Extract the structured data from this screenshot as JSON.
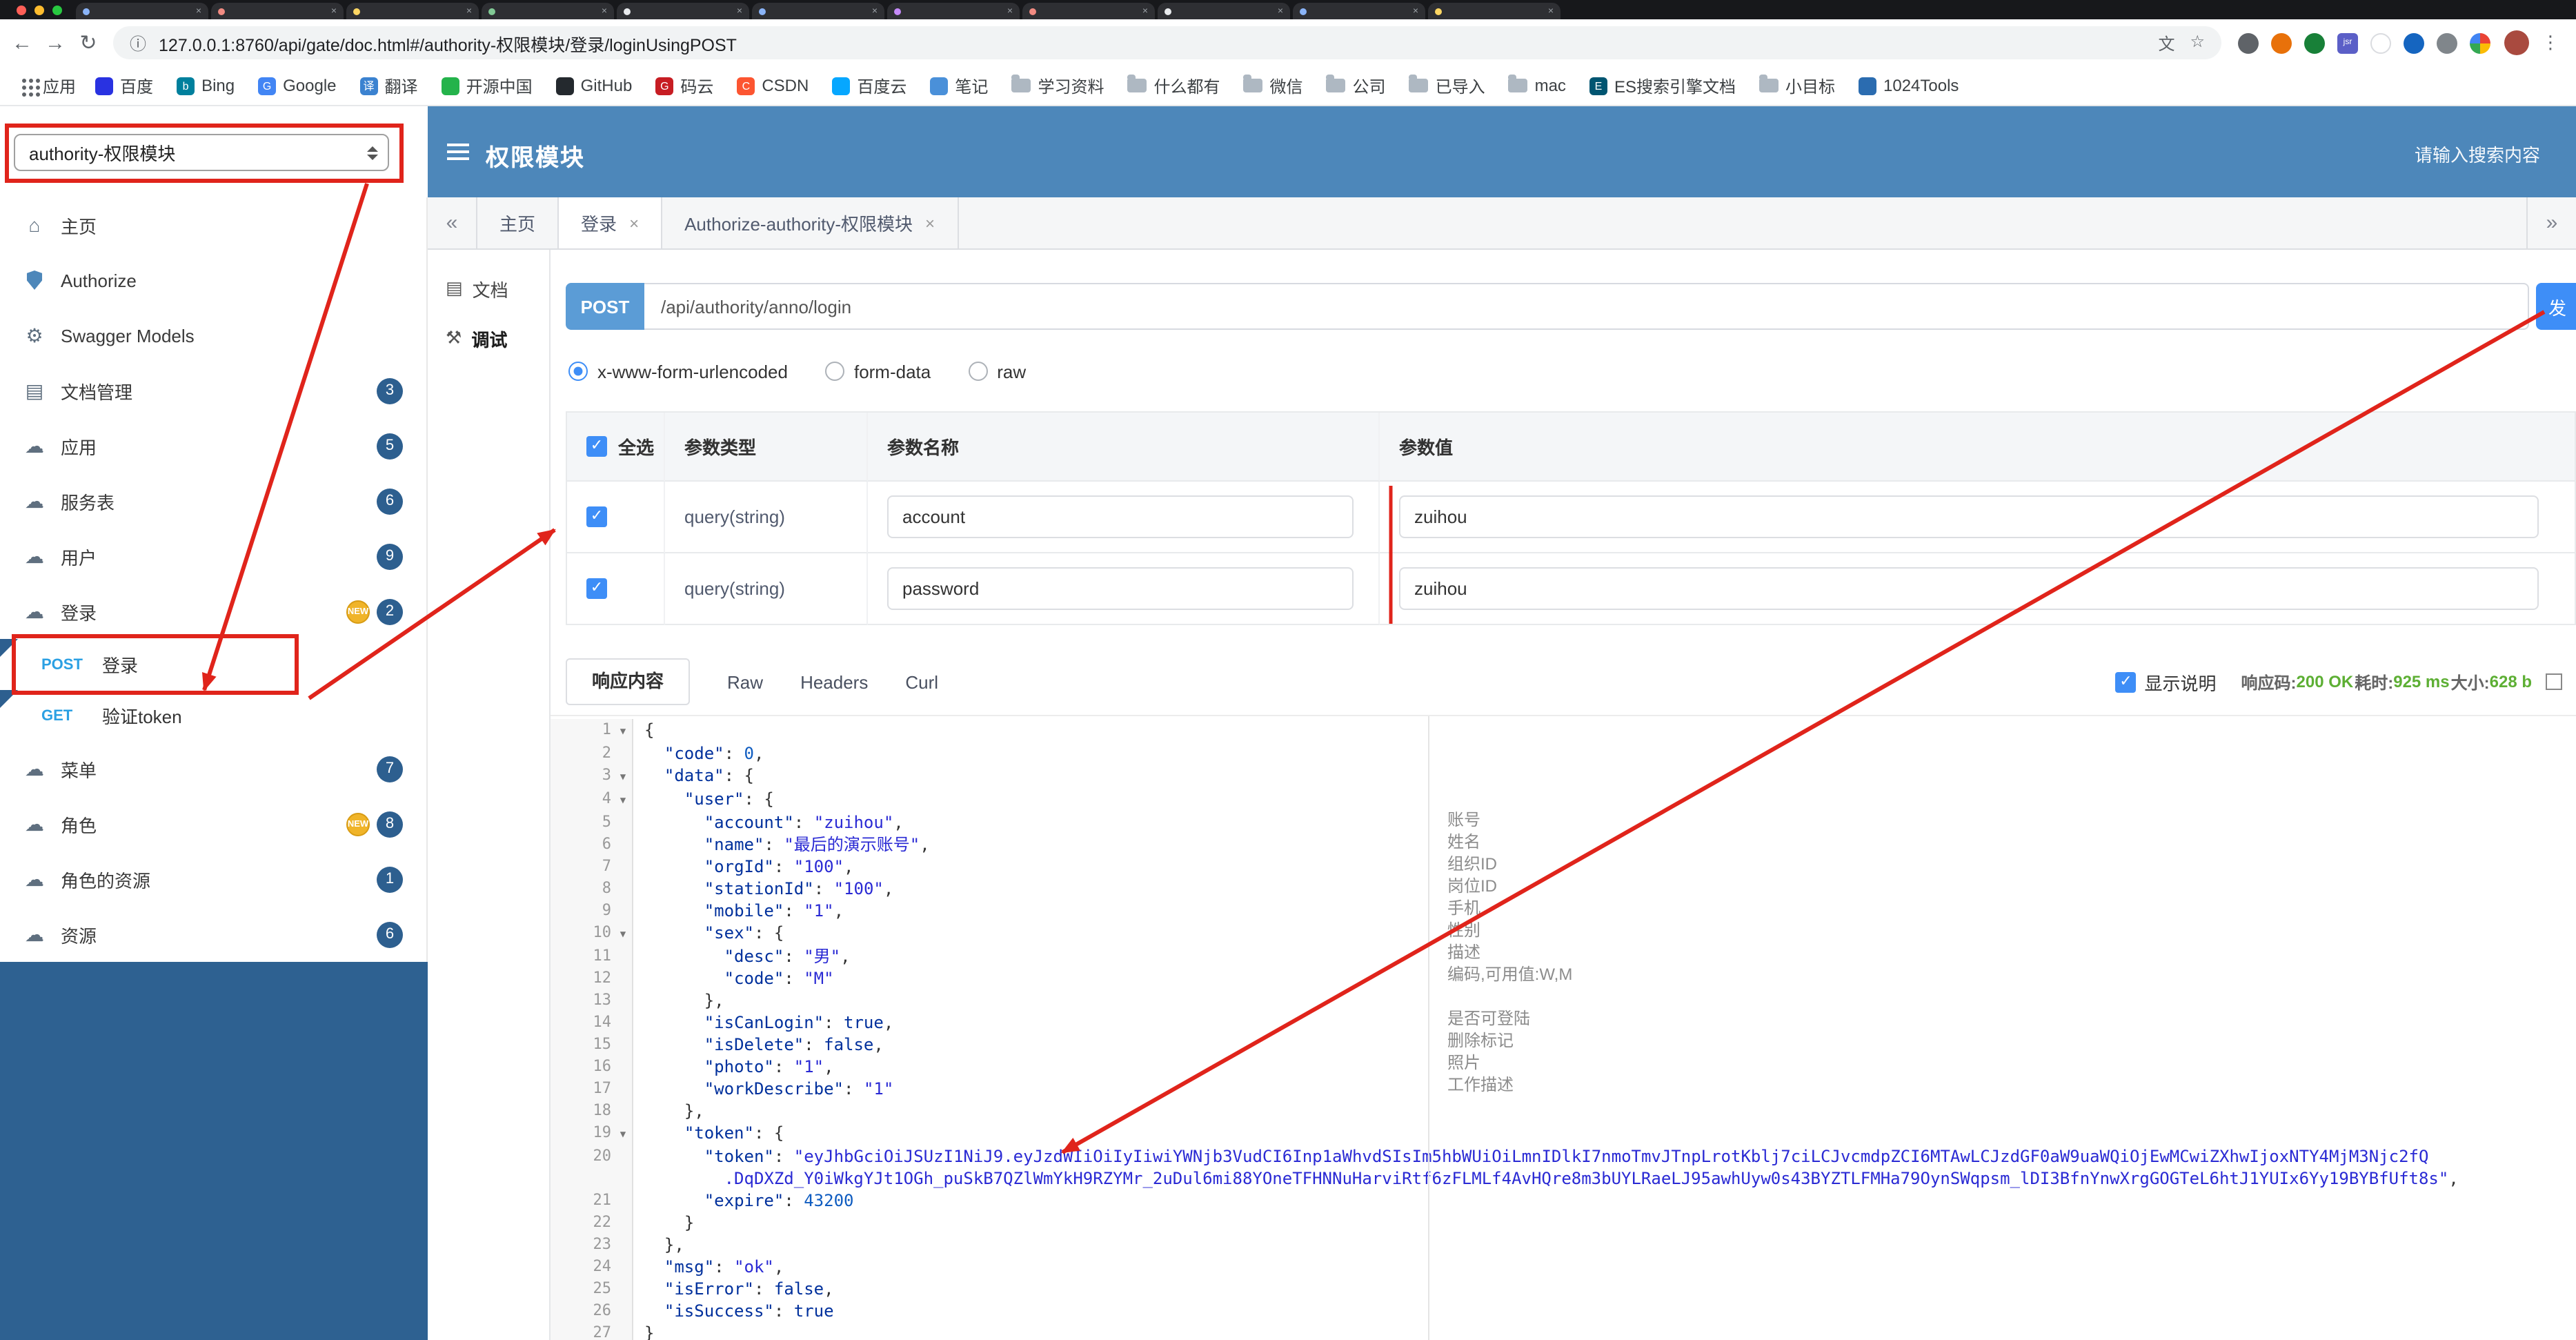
{
  "colors": {
    "header_blue": "#4d87ba",
    "sidebar_footer_blue": "#2e6191",
    "method_badge_blue": "#5b9cd6",
    "primary_blue": "#3e8ef7",
    "badge_navy": "#2d5f8f",
    "new_gold": "#f0b429",
    "success_green": "#5daf34",
    "annotation_red": "#e0241b"
  },
  "icon_glyphs": {
    "back-icon": "←",
    "forward-icon": "→",
    "reload-icon": "↻",
    "info-icon": "ⓘ",
    "star-icon": "☆",
    "translate-icon": "文",
    "overflow-icon": "⋮",
    "close-icon": "×",
    "chevron-left-icon": "«",
    "chevron-right-icon": "»",
    "home-icon": "⌂",
    "models-icon": "⚙",
    "doc-icon": "▤",
    "cloud-icon": "☁",
    "debug-icon": "⚒",
    "fold-icon": "▼",
    "check-icon": "✓"
  },
  "browser": {
    "url": "127.0.0.1:8760/api/gate/doc.html#/authority-权限模块/登录/loginUsingPOST",
    "tab_favicon_colors": [
      "#8ab4f8",
      "#f28b82",
      "#fdd663",
      "#81c995",
      "#e8eaed",
      "#8ab4f8",
      "#c58af9",
      "#f28b82",
      "#e8eaed",
      "#8ab4f8",
      "#fdd663"
    ],
    "extensions": [
      {
        "color": "#5f6368"
      },
      {
        "color": "#e8710a"
      },
      {
        "color": "#188038"
      },
      {
        "color": "#5b5fc7",
        "letter": "jsr"
      },
      {
        "color": "#ffffff",
        "border": true
      },
      {
        "color": "#1565c0"
      },
      {
        "color": "#80868b"
      },
      {
        "pinwheel": true
      }
    ],
    "bookmarks": {
      "apps_label": "应用",
      "items": [
        {
          "label": "百度",
          "type": "site",
          "color": "#2932e1"
        },
        {
          "label": "Bing",
          "type": "site",
          "color": "#00809d",
          "letter": "b"
        },
        {
          "label": "Google",
          "type": "site",
          "color": "#4285f4",
          "letter": "G"
        },
        {
          "label": "翻译",
          "type": "site",
          "color": "#3b82d0",
          "letter": "译"
        },
        {
          "label": "开源中国",
          "type": "site",
          "color": "#24b34b"
        },
        {
          "label": "GitHub",
          "type": "site",
          "color": "#24292e"
        },
        {
          "label": "码云",
          "type": "site",
          "color": "#c71d23",
          "letter": "G"
        },
        {
          "label": "CSDN",
          "type": "site",
          "color": "#fc5531",
          "letter": "C"
        },
        {
          "label": "百度云",
          "type": "site",
          "color": "#06a7ff"
        },
        {
          "label": "笔记",
          "type": "site",
          "color": "#4a90d9"
        },
        {
          "label": "学习资料",
          "type": "folder"
        },
        {
          "label": "什么都有",
          "type": "folder"
        },
        {
          "label": "微信",
          "type": "folder"
        },
        {
          "label": "公司",
          "type": "folder"
        },
        {
          "label": "已导入",
          "type": "folder"
        },
        {
          "label": "mac",
          "type": "folder"
        },
        {
          "label": "ES搜索引擎文档",
          "type": "site",
          "color": "#005571",
          "letter": "E"
        },
        {
          "label": "小目标",
          "type": "folder"
        },
        {
          "label": "1024Tools",
          "type": "site",
          "color": "#2b6cb0"
        }
      ]
    }
  },
  "header": {
    "module_select": "authority-权限模块",
    "title": "权限模块",
    "search_placeholder": "请输入搜索内容"
  },
  "sidebar": {
    "new_tag": "NEW",
    "items": [
      {
        "name": "home",
        "label": "主页",
        "icon": "home-icon"
      },
      {
        "name": "authorize",
        "label": "Authorize",
        "icon": "shield-icon"
      },
      {
        "name": "swagger-models",
        "label": "Swagger Models",
        "icon": "models-icon"
      },
      {
        "name": "doc-manage",
        "label": "文档管理",
        "icon": "doc-icon",
        "badge": "3"
      },
      {
        "name": "application",
        "label": "应用",
        "icon": "cloud-icon",
        "badge": "5"
      },
      {
        "name": "service-table",
        "label": "服务表",
        "icon": "cloud-icon",
        "badge": "6"
      },
      {
        "name": "user",
        "label": "用户",
        "icon": "cloud-icon",
        "badge": "9"
      },
      {
        "name": "login",
        "label": "登录",
        "icon": "cloud-icon",
        "badge": "2",
        "is_new": true
      },
      {
        "name": "login-post",
        "label": "登录",
        "method": "POST",
        "child": true,
        "selected": true
      },
      {
        "name": "verify-token-get",
        "label": "验证token",
        "method": "GET",
        "child": true
      },
      {
        "name": "menu",
        "label": "菜单",
        "icon": "cloud-icon",
        "badge": "7"
      },
      {
        "name": "role",
        "label": "角色",
        "icon": "cloud-icon",
        "badge": "8",
        "is_new": true
      },
      {
        "name": "role-resource",
        "label": "角色的资源",
        "icon": "cloud-icon",
        "badge": "1"
      },
      {
        "name": "resource",
        "label": "资源",
        "icon": "cloud-icon",
        "badge": "6"
      }
    ]
  },
  "tabs": {
    "items": [
      {
        "label": "主页",
        "closable": false
      },
      {
        "label": "登录",
        "closable": true,
        "active": true
      },
      {
        "label": "Authorize-authority-权限模块",
        "closable": true
      }
    ]
  },
  "doc_nav": [
    {
      "label": "文档",
      "icon": "doc-icon"
    },
    {
      "label": "调试",
      "icon": "debug-icon",
      "active": true
    }
  ],
  "debug": {
    "method": "POST",
    "path": "/api/authority/anno/login",
    "send_label": "发",
    "content_types": [
      "x-www-form-urlencoded",
      "form-data",
      "raw"
    ],
    "selected_content_type": "x-www-form-urlencoded",
    "param_table": {
      "headers": [
        "全选",
        "参数类型",
        "参数名称",
        "参数值"
      ],
      "rows": [
        {
          "checked": true,
          "type": "query(string)",
          "name": "account",
          "value": "zuihou"
        },
        {
          "checked": true,
          "type": "query(string)",
          "name": "password",
          "value": "zuihou"
        }
      ]
    }
  },
  "response": {
    "tabs": [
      "响应内容",
      "Raw",
      "Headers",
      "Curl"
    ],
    "active_tab": "响应内容",
    "show_desc": "显示说明",
    "meta": {
      "code_label": "响应码:",
      "code_value": "200 OK",
      "time_label": "耗时:",
      "time_value": "925 ms",
      "size_label": "大小:",
      "size_value": "628 b"
    },
    "fold_lines": [
      1,
      3,
      4,
      10,
      19
    ],
    "body_lines": [
      "{",
      "  \"code\": 0,",
      "  \"data\": {",
      "    \"user\": {",
      "      \"account\": \"zuihou\",",
      "      \"name\": \"最后的演示账号\",",
      "      \"orgId\": \"100\",",
      "      \"stationId\": \"100\",",
      "      \"mobile\": \"1\",",
      "      \"sex\": {",
      "        \"desc\": \"男\",",
      "        \"code\": \"M\"",
      "      },",
      "      \"isCanLogin\": true,",
      "      \"isDelete\": false,",
      "      \"photo\": \"1\",",
      "      \"workDescribe\": \"1\"",
      "    },",
      "    \"token\": {",
      [
        "      \"token\": \"eyJhbGciOiJSUzI1NiJ9.eyJzdWIiOiIyIiwiYWNjb3VudCI6Inp1aWhvdSIsIm5hbWUiOiLmnIDlkI7nmoTmvJTnpLrotKblj7ciLCJvcmdpZCI6MTAwLCJzdGF0aW9uaWQiOjEwMCwiZXhwIjoxNTY4MjM3Njc2fQ",
        "        .DqDXZd_Y0iWkgYJt1OGh_puSkB7QZlWmYkH9RZYMr_2uDul6mi88YOneTFHNNuHarviRtf6zFLMLf4AvHQre8m3bUYLRaeLJ95awhUyw0s43BYZTLFMHa79OynSWqpsm_lDI3BfnYnwXrgGOGTeL6htJ1YUIx6Yy19BYBfUft8s\","
      ],
      "      \"expire\": 43200",
      "    }",
      "  },",
      "  \"msg\": \"ok\",",
      "  \"isError\": false,",
      "  \"isSuccess\": true",
      "}"
    ],
    "annotations": [
      {
        "line": 5,
        "text": "账号"
      },
      {
        "line": 6,
        "text": "姓名"
      },
      {
        "line": 7,
        "text": "组织ID"
      },
      {
        "line": 8,
        "text": "岗位ID"
      },
      {
        "line": 9,
        "text": "手机"
      },
      {
        "line": 10,
        "text": "性别"
      },
      {
        "line": 11,
        "text": "描述"
      },
      {
        "line": 12,
        "text": "编码,可用值:W,M"
      },
      {
        "line": 14,
        "text": "是否可登陆"
      },
      {
        "line": 15,
        "text": "删除标记"
      },
      {
        "line": 16,
        "text": "照片"
      },
      {
        "line": 17,
        "text": "工作描述"
      }
    ]
  }
}
